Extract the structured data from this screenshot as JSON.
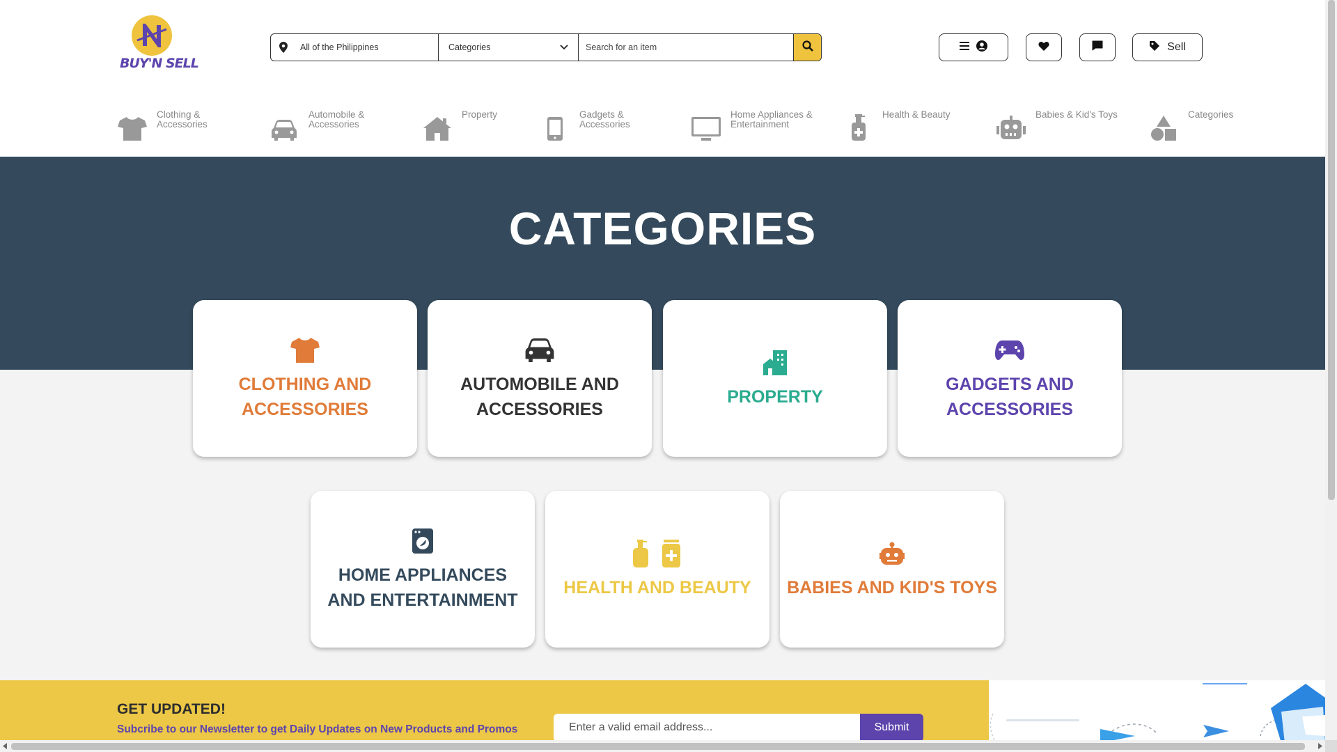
{
  "logo": {
    "text": "BUY'N SELL",
    "brand_color": "#5d44ad",
    "accent_color": "#efc33d"
  },
  "search": {
    "location": "All of the Philippines",
    "category": "Categories",
    "placeholder": "Search for an item"
  },
  "header_buttons": {
    "sell_label": "Sell"
  },
  "nav": [
    {
      "label": "Clothing &\nAccessories",
      "icon": "tshirt-icon"
    },
    {
      "label": "Automobile &\nAccessories",
      "icon": "car-icon"
    },
    {
      "label": "Property",
      "icon": "house-icon"
    },
    {
      "label": "Gadgets &\nAccessories",
      "icon": "phone-icon"
    },
    {
      "label": "Home Appliances &\nEntertainment",
      "icon": "monitor-icon"
    },
    {
      "label": "Health & Beauty",
      "icon": "bottle-icon"
    },
    {
      "label": "Babies & Kid's Toys",
      "icon": "robot-icon"
    },
    {
      "label": "Categories",
      "icon": "shapes-icon"
    }
  ],
  "hero": {
    "title": "CATEGORIES",
    "bg_color": "#344a5c"
  },
  "cards": [
    {
      "label": "CLOTHING AND ACCESSORIES",
      "color": "#e07b39",
      "icon": "tshirt-icon"
    },
    {
      "label": "AUTOMOBILE AND ACCESSORIES",
      "color": "#333333",
      "icon": "car-icon"
    },
    {
      "label": "PROPERTY",
      "color": "#2bab8f",
      "icon": "building-icon"
    },
    {
      "label": "GADGETS AND ACCESSORIES",
      "color": "#5d44ad",
      "icon": "gamepad-icon"
    },
    {
      "label": "HOME APPLIANCES AND ENTERTAINMENT",
      "color": "#344a5c",
      "icon": "washing-machine-icon"
    },
    {
      "label": "HEALTH AND BEAUTY",
      "color": "#ecc846",
      "icon": "medicine-bottles-icon"
    },
    {
      "label": "BABIES AND KID'S TOYS",
      "color": "#e07b39",
      "icon": "robot-icon"
    }
  ],
  "newsletter": {
    "title": "GET UPDATED!",
    "subtitle": "Subcribe to our Newsletter to get Daily Updates on New Products and Promos",
    "placeholder": "Enter a valid email address...",
    "button": "Submit"
  }
}
